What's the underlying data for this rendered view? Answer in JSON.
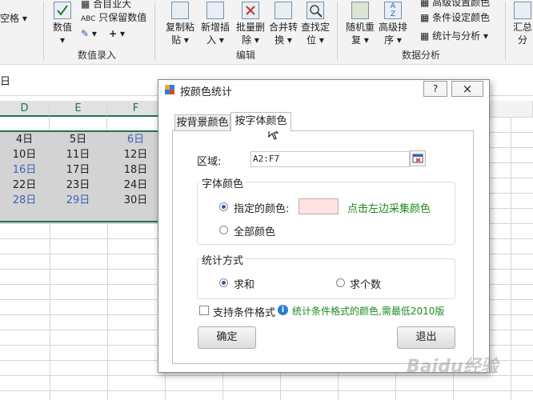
{
  "ribbon": {
    "left_partial": "空格",
    "numeric_btn": "数值",
    "small_items": [
      "合目业大",
      "只保留数值"
    ],
    "numeric_group": "数值录入",
    "edit_buttons": [
      {
        "top": "复制粘",
        "bottom": "贴"
      },
      {
        "top": "新增插",
        "bottom": "入"
      },
      {
        "top": "批量删",
        "bottom": "除"
      },
      {
        "top": "合并转",
        "bottom": "换"
      },
      {
        "top": "查找定",
        "bottom": "位"
      }
    ],
    "edit_group": "编辑",
    "analysis_buttons": [
      {
        "top": "随机重",
        "bottom": "复"
      },
      {
        "top": "高级排",
        "bottom": "序"
      }
    ],
    "analysis_small": [
      "高级设置颜色",
      "条件设定颜色",
      "统计与分析"
    ],
    "analysis_group": "数据分析",
    "right_partial": {
      "top": "汇总",
      "bottom": "分"
    },
    "plus_label": "+"
  },
  "formula_bar": {
    "cell_ref_partial": "日"
  },
  "sheet": {
    "columns": [
      "D",
      "E",
      "F"
    ],
    "rows": [
      [
        "4日",
        "5日",
        "6日"
      ],
      [
        "10日",
        "11日",
        "12日"
      ],
      [
        "16日",
        "17日",
        "18日"
      ],
      [
        "22日",
        "23日",
        "24日"
      ],
      [
        "28日",
        "29日",
        "30日"
      ]
    ],
    "blue_color": "#3a64b4"
  },
  "dialog": {
    "title": "按颜色统计",
    "help_btn": "?",
    "close_btn": "×",
    "tabs": [
      "按背景颜色",
      "按字体颜色"
    ],
    "active_tab": 1,
    "range_label": "区域:",
    "range_value": "A2:F7",
    "font_color_group": "字体颜色",
    "specified_color": "指定的颜色:",
    "swatch_color": "#ffe3e0",
    "pick_hint": "点击左边采集颜色",
    "all_colors": "全部颜色",
    "stat_group": "统计方式",
    "sum": "求和",
    "count": "求个数",
    "cond_format": "支持条件格式",
    "cond_hint": "统计条件格式的颜色,需最低2010版",
    "ok": "确定",
    "exit": "退出"
  },
  "watermark": "Baidu经验"
}
